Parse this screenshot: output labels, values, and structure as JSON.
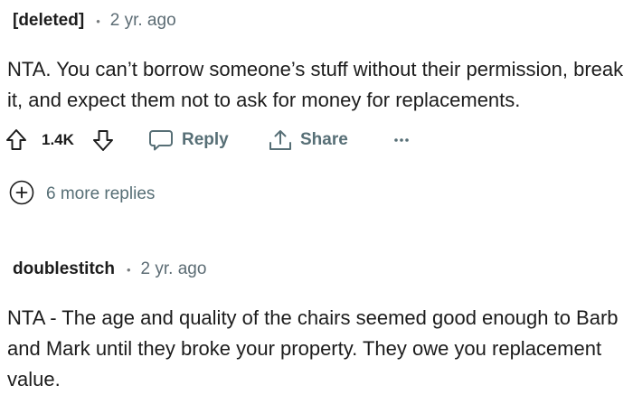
{
  "comments": [
    {
      "author": "[deleted]",
      "separator": "•",
      "time": "2 yr. ago",
      "body": "NTA. You can’t borrow someone’s stuff without their permission, break it, and expect them not to ask for money for replacements.",
      "actions": {
        "score": "1.4K",
        "reply_label": "Reply",
        "share_label": "Share",
        "more_label": "···"
      },
      "more_replies_label": "6 more replies"
    },
    {
      "author": "doublestitch",
      "separator": "•",
      "time": "2 yr. ago",
      "body": "NTA - The age and quality of the chairs seemed good enough to Barb and Mark until they broke your property. They owe you replacement value."
    }
  ],
  "icons": {
    "upvote": "upvote-arrow-icon",
    "downvote": "downvote-arrow-icon",
    "reply": "speech-bubble-icon",
    "share": "share-icon",
    "more": "overflow-menu-icon",
    "expand": "plus-circle-icon"
  },
  "colors": {
    "text": "#1c1c1c",
    "muted": "#576f76",
    "timestamp": "#5c6c74",
    "background": "#ffffff"
  }
}
